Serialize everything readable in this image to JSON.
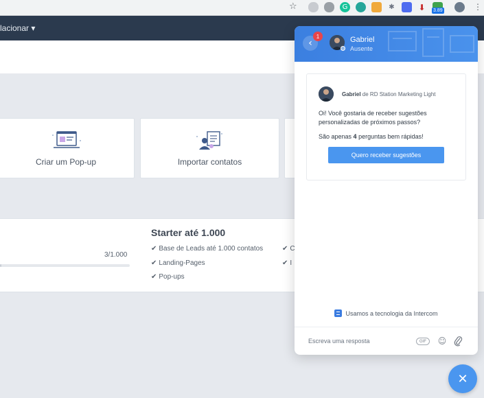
{
  "browser": {
    "toolbar_icons": [
      "star-icon",
      "extension-icons"
    ],
    "ext_badge": "3.89"
  },
  "nav": {
    "truncated_menu_label": "lacionar",
    "menu_chevron": "▾"
  },
  "cards": [
    {
      "label": "Criar um Pop-up",
      "icon": "popup-icon"
    },
    {
      "label": "Importar contatos",
      "icon": "import-contacts-icon"
    }
  ],
  "plan": {
    "title": "Starter até 1.000",
    "usage": "3/1.000",
    "usage_fraction": 0.003,
    "features": [
      "Base de Leads até 1.000 contatos",
      "Landing-Pages",
      "Pop-ups"
    ],
    "features_right_truncated": [
      "C",
      "I"
    ]
  },
  "messenger": {
    "unread_count": "1",
    "agent_name": "Gabriel",
    "agent_status": "Ausente",
    "message": {
      "sender_name": "Gabriel",
      "sender_suffix": " de RD Station Marketing Light",
      "paragraph1": "Oi! Você gostaria de receber sugestões personalizadas de próximos passos?",
      "paragraph2_prefix": "São apenas ",
      "paragraph2_bold": "4",
      "paragraph2_suffix": " perguntas bem rápidas!",
      "cta_label": "Quero receber sugestões"
    },
    "powered_by": "Usamos a tecnologia da Intercom",
    "composer_placeholder": "Escreva uma resposta",
    "gif_label": "GIF"
  },
  "colors": {
    "nav_bg": "#2b3a4e",
    "accent": "#4a96ef",
    "unread_badge": "#e8454b"
  }
}
